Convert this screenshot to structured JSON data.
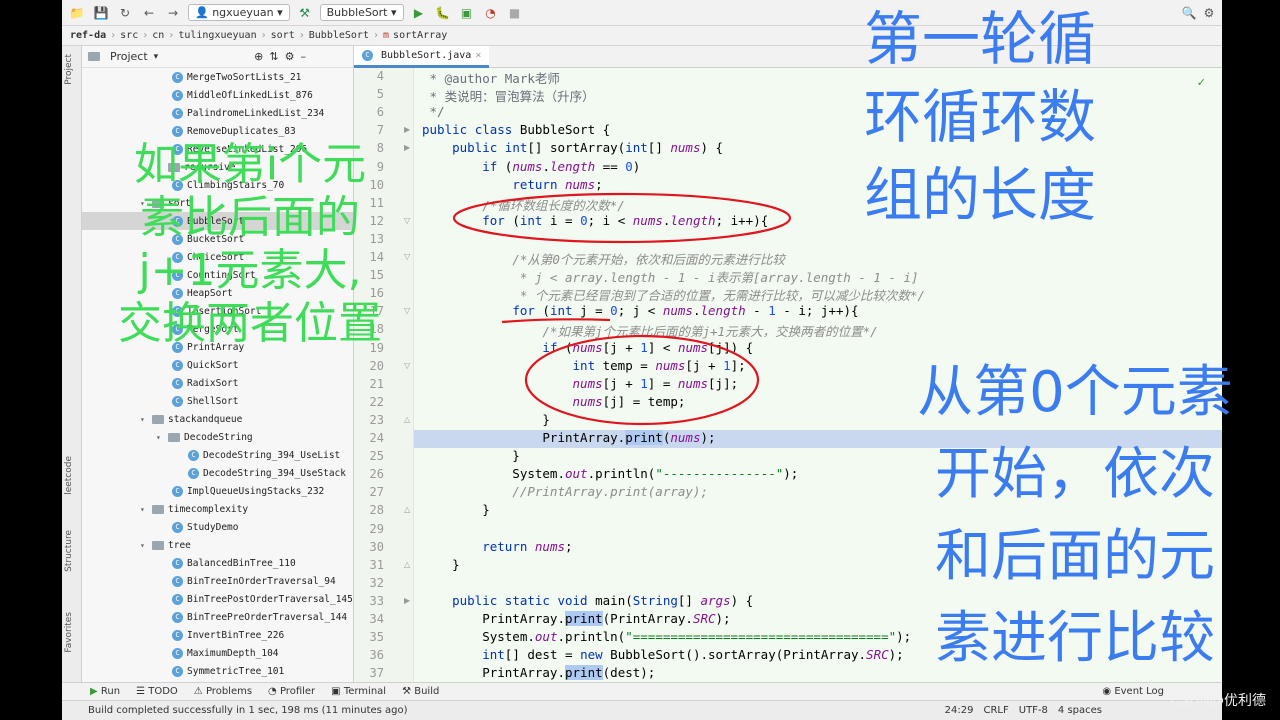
{
  "toolbar": {
    "run_config": "BubbleSort",
    "icons": [
      "open-icon",
      "save-icon",
      "sync-icon",
      "back-icon",
      "forward-icon",
      "build-icon",
      "run-icon",
      "debug-icon",
      "coverage-icon",
      "profile-icon",
      "search-icon",
      "settings-icon"
    ],
    "vcs_label": "ngxueyuan"
  },
  "breadcrumb": [
    "ref-da",
    "src",
    "cn",
    "tulingxueyuan",
    "sort",
    "BubbleSort",
    "sortArray"
  ],
  "project": {
    "header": "Project",
    "side_tabs": [
      "Project",
      "leetcode",
      "Structure",
      "Favorites"
    ],
    "tree": [
      {
        "label": "MergeTwoSortLists_21",
        "kind": "class"
      },
      {
        "label": "MiddleOfLinkedList_876",
        "kind": "class"
      },
      {
        "label": "PalindromeLinkedList_234",
        "kind": "class"
      },
      {
        "label": "RemoveDuplicates_83",
        "kind": "class"
      },
      {
        "label": "ReverseLinkedList_206",
        "kind": "class"
      },
      {
        "label": "recursive",
        "kind": "folder"
      },
      {
        "label": "ClimbingStairs_70",
        "kind": "class"
      },
      {
        "label": "sort",
        "kind": "folder"
      },
      {
        "label": "BubbleSort",
        "kind": "class",
        "selected": true
      },
      {
        "label": "BucketSort",
        "kind": "class"
      },
      {
        "label": "ChoiceSort",
        "kind": "class"
      },
      {
        "label": "CountingSort",
        "kind": "class"
      },
      {
        "label": "HeapSort",
        "kind": "class"
      },
      {
        "label": "InsertionSort",
        "kind": "class"
      },
      {
        "label": "MergeSort",
        "kind": "class"
      },
      {
        "label": "PrintArray",
        "kind": "class"
      },
      {
        "label": "QuickSort",
        "kind": "class"
      },
      {
        "label": "RadixSort",
        "kind": "class"
      },
      {
        "label": "ShellSort",
        "kind": "class"
      },
      {
        "label": "stackandqueue",
        "kind": "folder"
      },
      {
        "label": "DecodeString",
        "kind": "folder"
      },
      {
        "label": "DecodeString_394_UseList",
        "kind": "class"
      },
      {
        "label": "DecodeString_394_UseStack",
        "kind": "class"
      },
      {
        "label": "ImplQueueUsingStacks_232",
        "kind": "class"
      },
      {
        "label": "timecomplexity",
        "kind": "folder"
      },
      {
        "label": "StudyDemo",
        "kind": "class"
      },
      {
        "label": "tree",
        "kind": "folder"
      },
      {
        "label": "BalancedBinTree_110",
        "kind": "class"
      },
      {
        "label": "BinTreeInOrderTraversal_94",
        "kind": "class"
      },
      {
        "label": "BinTreePostOrderTraversal_145",
        "kind": "class"
      },
      {
        "label": "BinTreePreOrderTraversal_144",
        "kind": "class"
      },
      {
        "label": "InvertBinTree_226",
        "kind": "class"
      },
      {
        "label": "MaximumDepth_104",
        "kind": "class"
      },
      {
        "label": "SymmetricTree_101",
        "kind": "class"
      }
    ]
  },
  "editor": {
    "tab": "BubbleSort.java",
    "line_numbers": [
      "4",
      "5",
      "6",
      "7",
      "8",
      "9",
      "10",
      "11",
      "12",
      "13",
      "14",
      "15",
      "16",
      "17",
      "18",
      "19",
      "20",
      "21",
      "22",
      "23",
      "24",
      "25",
      "26",
      "27",
      "28",
      "29",
      "30",
      "31",
      "32",
      "33",
      "34",
      "35",
      "36",
      "37"
    ],
    "lines": [
      " * @author Mark老师",
      " * 类说明：冒泡算法（升序）",
      " */",
      "public class BubbleSort {",
      "    public int[] sortArray(int[] nums) {",
      "        if (nums.length == 0)",
      "            return nums;",
      "        /*循环数组长度的次数*/",
      "        for (int i = 0; i < nums.length; i++){",
      "",
      "            /*从第0个元素开始，依次和后面的元素进行比较",
      "             * j < array.length - 1 - i表示第[array.length - 1 - i]",
      "             * 个元素已经冒泡到了合适的位置，无需进行比较，可以减少比较次数*/",
      "            for (int j = 0; j < nums.length - 1 - i; j++){",
      "                /*如果第j个元素比后面的第j+1元素大，交换两者的位置*/",
      "                if (nums[j + 1] < nums[j]) {",
      "                    int temp = nums[j + 1];",
      "                    nums[j + 1] = nums[j];",
      "                    nums[j] = temp;",
      "                }",
      "                PrintArray.print(nums);",
      "            }",
      "            System.out.println(\"---------------\");",
      "            //PrintArray.print(array);",
      "        }",
      "",
      "        return nums;",
      "    }",
      "",
      "    public static void main(String[] args) {",
      "        PrintArray.print(PrintArray.SRC);",
      "        System.out.println(\"==================================\");",
      "        int[] dest = new BubbleSort().sortArray(PrintArray.SRC);",
      "        PrintArray.print(dest);"
    ]
  },
  "bottom_tabs": [
    "Run",
    "TODO",
    "Problems",
    "Profiler",
    "Terminal",
    "Build"
  ],
  "event_log": "Event Log",
  "status": {
    "message": "Build completed successfully in 1 sec, 198 ms (11 minutes ago)",
    "position": "24:29",
    "line_sep": "CRLF",
    "encoding": "UTF-8",
    "indent": "4 spaces"
  },
  "annotations": {
    "green": [
      "如果第i个元",
      "素比后面的",
      "j+1元素大,",
      "交换两者位置"
    ],
    "blue_top": [
      "第一轮循",
      "环循环数",
      "组的长度"
    ],
    "blue_right": [
      "从第0个元素",
      "开始，依次",
      "和后面的元",
      "素进行比较"
    ]
  },
  "watermark": "CSDN@优利德",
  "colors": {
    "annotation_green": "#3fdc5a",
    "annotation_blue": "#3b7cf0",
    "circle_red": "#e0151d",
    "editor_bg": "#f3faf1",
    "current_line": "#c9d8ef"
  }
}
